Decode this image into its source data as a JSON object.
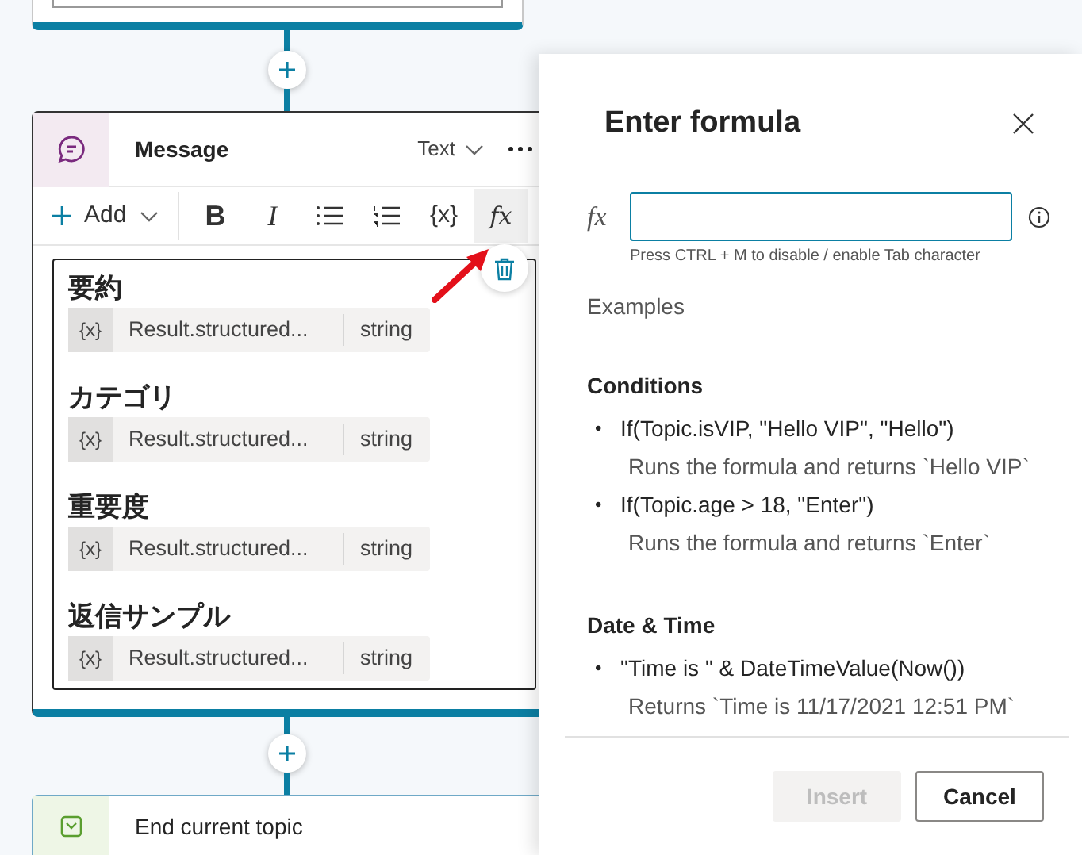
{
  "message_card": {
    "title": "Message",
    "format": "Text",
    "add_label": "Add",
    "toolbar": [
      {
        "kind": "bold",
        "label": "B",
        "selected": false
      },
      {
        "kind": "italic",
        "label": "I",
        "selected": false
      },
      {
        "kind": "bullets",
        "selected": false
      },
      {
        "kind": "numbered",
        "selected": false
      },
      {
        "kind": "glyph",
        "label": "{x}",
        "selected": false
      },
      {
        "kind": "glyph",
        "label": "fx",
        "selected": true
      }
    ],
    "items": [
      {
        "heading": "要約",
        "chip_label": "{x}",
        "variable": "Result.structured...",
        "type": "string"
      },
      {
        "heading": "カテゴリ",
        "chip_label": "{x}",
        "variable": "Result.structured...",
        "type": "string"
      },
      {
        "heading": "重要度",
        "chip_label": "{x}",
        "variable": "Result.structured...",
        "type": "string"
      },
      {
        "heading": "返信サンプル",
        "chip_label": "{x}",
        "variable": "Result.structured...",
        "type": "string"
      }
    ]
  },
  "end_card": {
    "title": "End current topic"
  },
  "formula_panel": {
    "title": "Enter formula",
    "fx_label": "fx",
    "hint": "Press CTRL + M to disable / enable Tab character",
    "examples_label": "Examples",
    "sections": [
      {
        "heading": "Conditions",
        "examples": [
          {
            "marker": "•",
            "formula": "If(Topic.isVIP, \"Hello VIP\", \"Hello\")",
            "description": "Runs the formula and returns `Hello VIP`"
          },
          {
            "marker": "•",
            "formula": "If(Topic.age > 18, \"Enter\")",
            "description": "Runs the formula and returns `Enter`"
          }
        ]
      },
      {
        "heading": "Date & Time",
        "examples": [
          {
            "marker": "•",
            "formula": "\"Time is \" & DateTimeValue(Now())",
            "description": "Returns `Time is 11/17/2021 12:51 PM`"
          }
        ]
      }
    ],
    "buttons": [
      {
        "label": "Insert",
        "disabled": true
      },
      {
        "label": "Cancel",
        "disabled": false
      }
    ]
  }
}
